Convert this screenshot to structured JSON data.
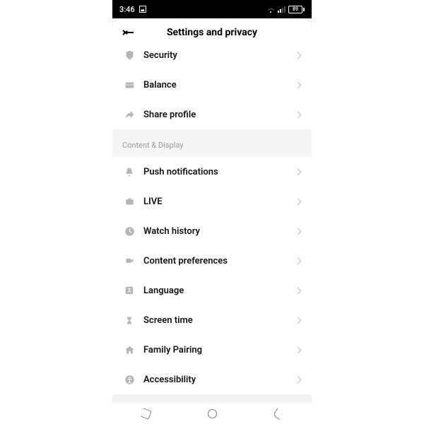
{
  "status_bar": {
    "time": "3:46",
    "battery": "89"
  },
  "header": {
    "title": "Settings and privacy"
  },
  "section1": {
    "items": [
      {
        "label": "Security"
      },
      {
        "label": "Balance"
      },
      {
        "label": "Share profile"
      }
    ]
  },
  "section2": {
    "title": "Content & Display",
    "items": [
      {
        "label": "Push notifications"
      },
      {
        "label": "LIVE"
      },
      {
        "label": "Watch history"
      },
      {
        "label": "Content preferences"
      },
      {
        "label": "Language"
      },
      {
        "label": "Screen time"
      },
      {
        "label": "Family Pairing"
      },
      {
        "label": "Accessibility"
      }
    ]
  }
}
